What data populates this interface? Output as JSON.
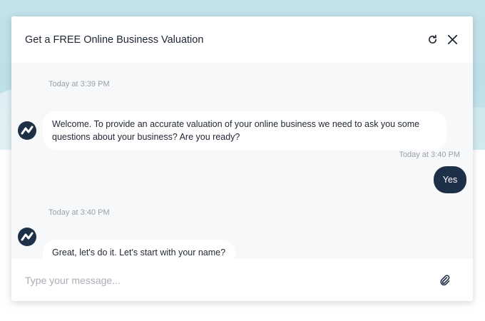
{
  "widget": {
    "title": "Get a FREE Online Business Valuation",
    "icons": {
      "refresh": "refresh-icon",
      "close": "close-icon",
      "attach": "paperclip-icon",
      "bot": "trend-logo-icon"
    },
    "colors": {
      "accent": "#1e3048",
      "bubble_bot": "#ffffff",
      "panel": "#f7f8fa",
      "timestamp": "#9aa0a8"
    }
  },
  "messages": [
    {
      "sender": "bot",
      "time": "Today at 3:39 PM",
      "lines": [
        "Welcome. To provide an accurate valuation of your online business we need to ask you some",
        "questions about your business? Are you ready?"
      ]
    },
    {
      "sender": "user",
      "time": "Today at 3:40 PM",
      "text": "Yes"
    },
    {
      "sender": "bot",
      "time": "Today at 3:40 PM",
      "text": "Great, let's do it. Let's start with your name?"
    }
  ],
  "composer": {
    "placeholder": "Type your message..."
  }
}
